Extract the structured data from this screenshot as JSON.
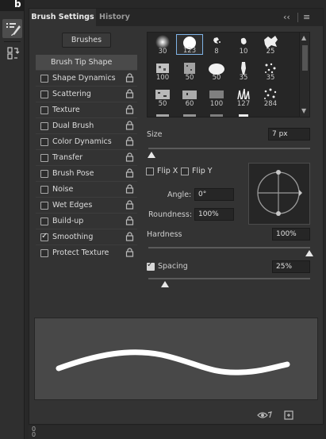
{
  "panel": {
    "tabs": [
      {
        "label": "Brush Settings",
        "active": true
      },
      {
        "label": "History",
        "active": false
      }
    ],
    "brushes_button": "Brushes"
  },
  "options": [
    {
      "label": "Brush Tip Shape",
      "checkbox": false,
      "checked": false,
      "lock": false,
      "selected": true
    },
    {
      "label": "Shape Dynamics",
      "checkbox": true,
      "checked": false,
      "lock": true
    },
    {
      "label": "Scattering",
      "checkbox": true,
      "checked": false,
      "lock": true
    },
    {
      "label": "Texture",
      "checkbox": true,
      "checked": false,
      "lock": true
    },
    {
      "label": "Dual Brush",
      "checkbox": true,
      "checked": false,
      "lock": true
    },
    {
      "label": "Color Dynamics",
      "checkbox": true,
      "checked": false,
      "lock": true
    },
    {
      "label": "Transfer",
      "checkbox": true,
      "checked": false,
      "lock": true
    },
    {
      "label": "Brush Pose",
      "checkbox": true,
      "checked": false,
      "lock": true
    },
    {
      "label": "Noise",
      "checkbox": true,
      "checked": false,
      "lock": true
    },
    {
      "label": "Wet Edges",
      "checkbox": true,
      "checked": false,
      "lock": true
    },
    {
      "label": "Build-up",
      "checkbox": true,
      "checked": false,
      "lock": true
    },
    {
      "label": "Smoothing",
      "checkbox": true,
      "checked": true,
      "lock": true
    },
    {
      "label": "Protect Texture",
      "checkbox": true,
      "checked": false,
      "lock": true
    }
  ],
  "presets": [
    "30",
    "123",
    "8",
    "10",
    "25",
    "100",
    "50",
    "50",
    "35",
    "35",
    "50",
    "60",
    "100",
    "127",
    "284"
  ],
  "selected_preset": "123",
  "size": {
    "label": "Size",
    "value": "7 px"
  },
  "flip_x": {
    "label": "Flip X",
    "checked": false
  },
  "flip_y": {
    "label": "Flip Y",
    "checked": false
  },
  "angle": {
    "label": "Angle:",
    "value": "0°"
  },
  "roundness": {
    "label": "Roundness:",
    "value": "100%"
  },
  "hardness": {
    "label": "Hardness",
    "value": "100%"
  },
  "spacing": {
    "label": "Spacing",
    "value": "25%",
    "checked": true
  },
  "footer": {
    "top_label": "0",
    "bottom_label": "0"
  },
  "tool_strip": {
    "top_label": "b"
  },
  "colors": {
    "panel": "#333333",
    "accent_selected": "#7fb3e6",
    "preview_bg": "#484848"
  }
}
